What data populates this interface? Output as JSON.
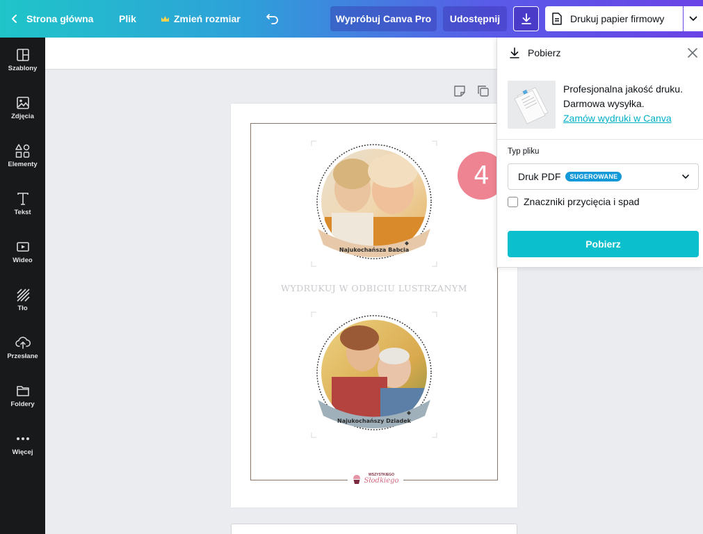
{
  "topbar": {
    "home_label": "Strona główna",
    "file_label": "Plik",
    "resize_label": "Zmień rozmiar",
    "try_pro_label": "Wypróbuj Canva Pro",
    "share_label": "Udostępnij",
    "print_label": "Drukuj papier firmowy"
  },
  "sidebar": {
    "items": [
      {
        "label": "Szablony",
        "icon": "templates-icon"
      },
      {
        "label": "Zdjęcia",
        "icon": "photos-icon"
      },
      {
        "label": "Elementy",
        "icon": "elements-icon"
      },
      {
        "label": "Tekst",
        "icon": "text-icon"
      },
      {
        "label": "Wideo",
        "icon": "video-icon"
      },
      {
        "label": "Tło",
        "icon": "background-icon"
      },
      {
        "label": "Przesłane",
        "icon": "upload-icon"
      },
      {
        "label": "Foldery",
        "icon": "folder-icon"
      },
      {
        "label": "Więcej",
        "icon": "more-icon"
      }
    ]
  },
  "design": {
    "badge_top": "Najukochańsza Babcia",
    "mirror_text": "WYDRUKUJ W ODBICIU LUSTRZANYM",
    "badge_bottom": "Najukochańszy Dziadek",
    "brand_top": "WSZYSTKIEGO",
    "brand_bottom": "Słodkiego"
  },
  "step_number": "4",
  "download_panel": {
    "title": "Pobierz",
    "promo_line1": "Profesjonalna jakość druku.",
    "promo_line2": "Darmowa wysyłka.",
    "promo_link": "Zamów wydruki w Canva",
    "file_type_label": "Typ pliku",
    "file_type_value": "Druk PDF",
    "suggested_badge": "SUGEROWANE",
    "crop_marks_label": "Znaczniki przycięcia i spad",
    "download_button": "Pobierz"
  },
  "colors": {
    "accent": "#0cbfcc",
    "link": "#00b0c6",
    "badge": "#1499d8",
    "step_badge": "#ee8391",
    "sidebar_bg": "#18191b"
  }
}
